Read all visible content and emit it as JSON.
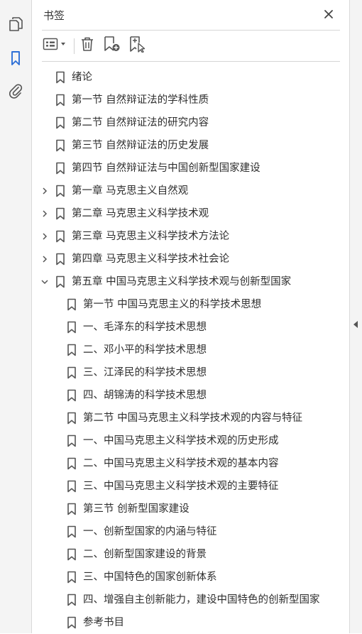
{
  "side_nav": {
    "items": [
      {
        "icon": "pages-icon"
      },
      {
        "icon": "bookmark-icon",
        "active": true
      },
      {
        "icon": "attachment-icon"
      }
    ]
  },
  "panel": {
    "title": "书签",
    "close_icon": "close-icon"
  },
  "toolbar": {
    "buttons": [
      "options-menu-icon",
      "delete-bookmark-icon",
      "new-bookmark-icon",
      "bookmark-from-selection-icon"
    ]
  },
  "bookmarks": [
    {
      "label": "绪论",
      "level": 0,
      "expander": "none"
    },
    {
      "label": "第一节  自然辩证法的学科性质",
      "level": 0,
      "expander": "none"
    },
    {
      "label": "第二节  自然辩证法的研究内容",
      "level": 0,
      "expander": "none"
    },
    {
      "label": "第三节  自然辩证法的历史发展",
      "level": 0,
      "expander": "none"
    },
    {
      "label": "第四节  自然辩证法与中国创新型国家建设",
      "level": 0,
      "expander": "none"
    },
    {
      "label": "第一章  马克思主义自然观",
      "level": 0,
      "expander": "collapsed"
    },
    {
      "label": "第二章  马克思主义科学技术观",
      "level": 0,
      "expander": "collapsed"
    },
    {
      "label": "第三章  马克思主义科学技术方法论",
      "level": 0,
      "expander": "collapsed"
    },
    {
      "label": "第四章  马克思主义科学技术社会论",
      "level": 0,
      "expander": "collapsed"
    },
    {
      "label": "第五章  中国马克思主义科学技术观与创新型国家",
      "level": 0,
      "expander": "expanded"
    },
    {
      "label": "第一节  中国马克思主义的科学技术思想",
      "level": 1,
      "expander": "none"
    },
    {
      "label": "一、毛泽东的科学技术思想",
      "level": 1,
      "expander": "none"
    },
    {
      "label": "二、邓小平的科学技术思想",
      "level": 1,
      "expander": "none"
    },
    {
      "label": "三、江泽民的科学技术思想",
      "level": 1,
      "expander": "none"
    },
    {
      "label": "四、胡锦涛的科学技术思想",
      "level": 1,
      "expander": "none"
    },
    {
      "label": "第二节  中国马克思主义科学技术观的内容与特征",
      "level": 1,
      "expander": "none"
    },
    {
      "label": "一、中国马克思主义科学技术观的历史形成",
      "level": 1,
      "expander": "none"
    },
    {
      "label": "二、中国马克思主义科学技术观的基本内容",
      "level": 1,
      "expander": "none"
    },
    {
      "label": "三、中国马克思主义科学技术观的主要特征",
      "level": 1,
      "expander": "none"
    },
    {
      "label": "第三节  创新型国家建设",
      "level": 1,
      "expander": "none"
    },
    {
      "label": "一、创新型国家的内涵与特征",
      "level": 1,
      "expander": "none"
    },
    {
      "label": "二、创新型国家建设的背景",
      "level": 1,
      "expander": "none"
    },
    {
      "label": "三、中国特色的国家创新体系",
      "level": 1,
      "expander": "none"
    },
    {
      "label": "四、增强自主创新能力，建设中国特色的创新型国家",
      "level": 1,
      "expander": "none"
    },
    {
      "label": "参考书目",
      "level": 1,
      "expander": "none"
    }
  ],
  "colors": {
    "accent": "#2d6fd6",
    "icon": "#555555",
    "text": "#2e2e2e"
  }
}
